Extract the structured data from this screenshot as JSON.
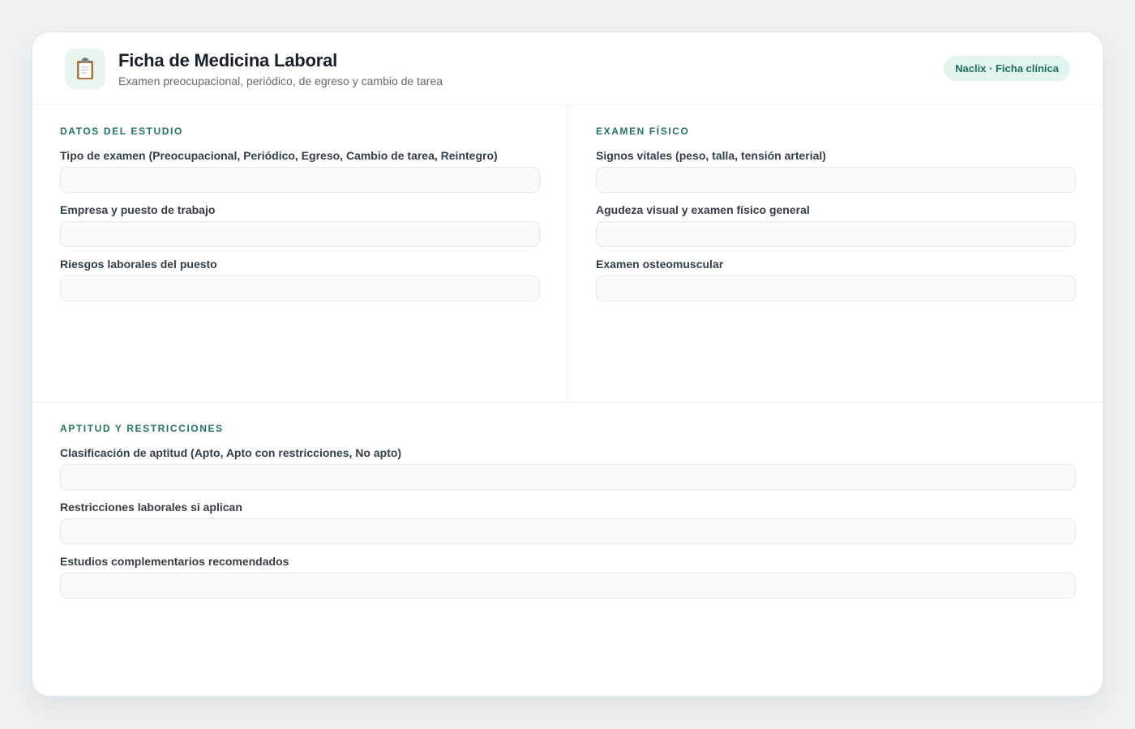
{
  "header": {
    "title": "Ficha de Medicina Laboral",
    "subtitle": "Examen preocupacional, periódico, de egreso y cambio de tarea",
    "badge": "Naclix · Ficha clínica",
    "icon": "clipboard-icon"
  },
  "colors": {
    "accent": "#217465",
    "badge_bg": "#e3f4ee",
    "input_bg": "#f8fafc"
  },
  "sections": {
    "datos": {
      "title": "DATOS DEL ESTUDIO",
      "fields": [
        {
          "label": "Tipo de examen (Preocupacional, Periódico, Egreso, Cambio de tarea, Reintegro)",
          "value": ""
        },
        {
          "label": "Empresa y puesto de trabajo",
          "value": ""
        },
        {
          "label": "Riesgos laborales del puesto",
          "value": ""
        }
      ]
    },
    "examen": {
      "title": "EXAMEN FÍSICO",
      "fields": [
        {
          "label": "Signos vitales (peso, talla, tensión arterial)",
          "value": ""
        },
        {
          "label": "Agudeza visual y examen físico general",
          "value": ""
        },
        {
          "label": "Examen osteomuscular",
          "value": ""
        }
      ]
    },
    "aptitud": {
      "title": "APTITUD Y RESTRICCIONES",
      "fields": [
        {
          "label": "Clasificación de aptitud (Apto, Apto con restricciones, No apto)",
          "value": ""
        },
        {
          "label": "Restricciones laborales si aplican",
          "value": ""
        },
        {
          "label": "Estudios complementarios recomendados",
          "value": ""
        }
      ]
    }
  }
}
